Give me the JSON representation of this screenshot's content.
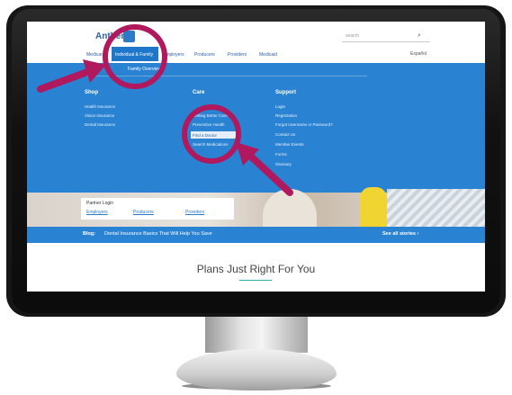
{
  "header": {
    "logo_text": "Anthem",
    "search_placeholder": "search",
    "language": "Español"
  },
  "nav": {
    "items": [
      "Medicare",
      "Individual & Family",
      "Employers",
      "Producers",
      "Providers",
      "Medicaid"
    ],
    "sub_item": "Family Overview"
  },
  "mega_menu": {
    "shop": {
      "heading": "Shop",
      "items": [
        "Health Insurance",
        "Vision Insurance",
        "Dental Insurance"
      ]
    },
    "care": {
      "heading": "Care",
      "items": [
        "Getting Better Care",
        "Preventive Health",
        "Find a Doctor",
        "Search Medications"
      ]
    },
    "support": {
      "heading": "Support",
      "items": [
        "Login",
        "Registration",
        "Forgot Username or Password?",
        "Contact Us",
        "Member Events",
        "Forms",
        "Glossary"
      ]
    }
  },
  "partner": {
    "title": "Partner Login",
    "links": [
      "Employers",
      "Producers",
      "Providers"
    ]
  },
  "blog": {
    "label": "Blog:",
    "text": "Dental Insurance Basics That Will Help You Save",
    "all": "See all stories ›"
  },
  "hero_title": "Plans Just Right For You",
  "colors": {
    "accent": "#2a82d2",
    "annotation": "#b0195e"
  }
}
